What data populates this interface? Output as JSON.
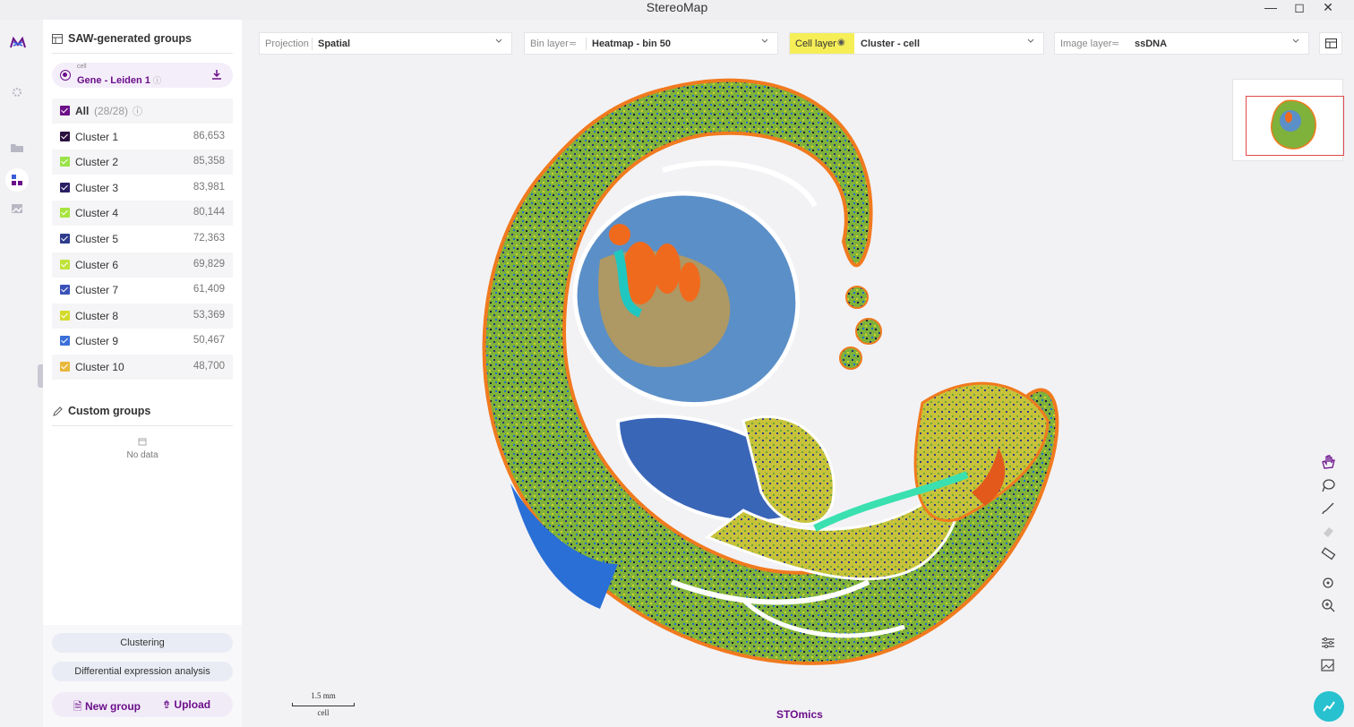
{
  "window": {
    "title": "StereoMap",
    "controls": [
      "minimize",
      "maximize",
      "close"
    ]
  },
  "rail": {
    "icons": [
      "app-logo-icon",
      "settings-icon",
      "folder-icon",
      "groups-icon",
      "image-icon"
    ]
  },
  "panel": {
    "header": "SAW-generated groups",
    "selection": {
      "kind": "cell",
      "name": "Gene - Leiden 1"
    },
    "all": {
      "label": "All",
      "count": "(28/28)"
    },
    "clusters": [
      {
        "label": "Cluster 1",
        "count": "86,653",
        "color": "#2b1040"
      },
      {
        "label": "Cluster 2",
        "count": "85,358",
        "color": "#9ae34a"
      },
      {
        "label": "Cluster 3",
        "count": "83,981",
        "color": "#2a1f63"
      },
      {
        "label": "Cluster 4",
        "count": "80,144",
        "color": "#a6e43e"
      },
      {
        "label": "Cluster 5",
        "count": "72,363",
        "color": "#2f3c8c"
      },
      {
        "label": "Cluster 6",
        "count": "69,829",
        "color": "#c0e33a"
      },
      {
        "label": "Cluster 7",
        "count": "61,409",
        "color": "#3a52b8"
      },
      {
        "label": "Cluster 8",
        "count": "53,369",
        "color": "#d4da2c"
      },
      {
        "label": "Cluster 9",
        "count": "50,467",
        "color": "#3a6fd8"
      },
      {
        "label": "Cluster 10",
        "count": "48,700",
        "color": "#e8b83a"
      }
    ],
    "custom_header": "Custom groups",
    "no_data": "No data",
    "buttons": {
      "clustering": "Clustering",
      "dea": "Differential expression analysis",
      "new_group": "New group",
      "upload": "Upload"
    }
  },
  "toolbar": {
    "projection": {
      "label": "Projection",
      "value": "Spatial"
    },
    "bin_layer": {
      "label": "Bin layer",
      "value": "Heatmap - bin 50"
    },
    "cell_layer": {
      "label": "Cell layer",
      "value": "Cluster - cell"
    },
    "image_layer": {
      "label": "Image layer",
      "value": "ssDNA"
    }
  },
  "scale": {
    "distance": "1.5 mm",
    "unit": "cell"
  },
  "brand": "STOmics",
  "tools": [
    "hand-icon",
    "lasso-icon",
    "brush-icon",
    "eraser-icon",
    "ruler-icon",
    "locate-icon",
    "zoom-icon",
    "sliders-icon",
    "export-image-icon"
  ],
  "colors": {
    "accent": "#6b0f8a",
    "cell_layer_highlight": "#f6ee57",
    "tissue_outline": "#f07a1f"
  }
}
